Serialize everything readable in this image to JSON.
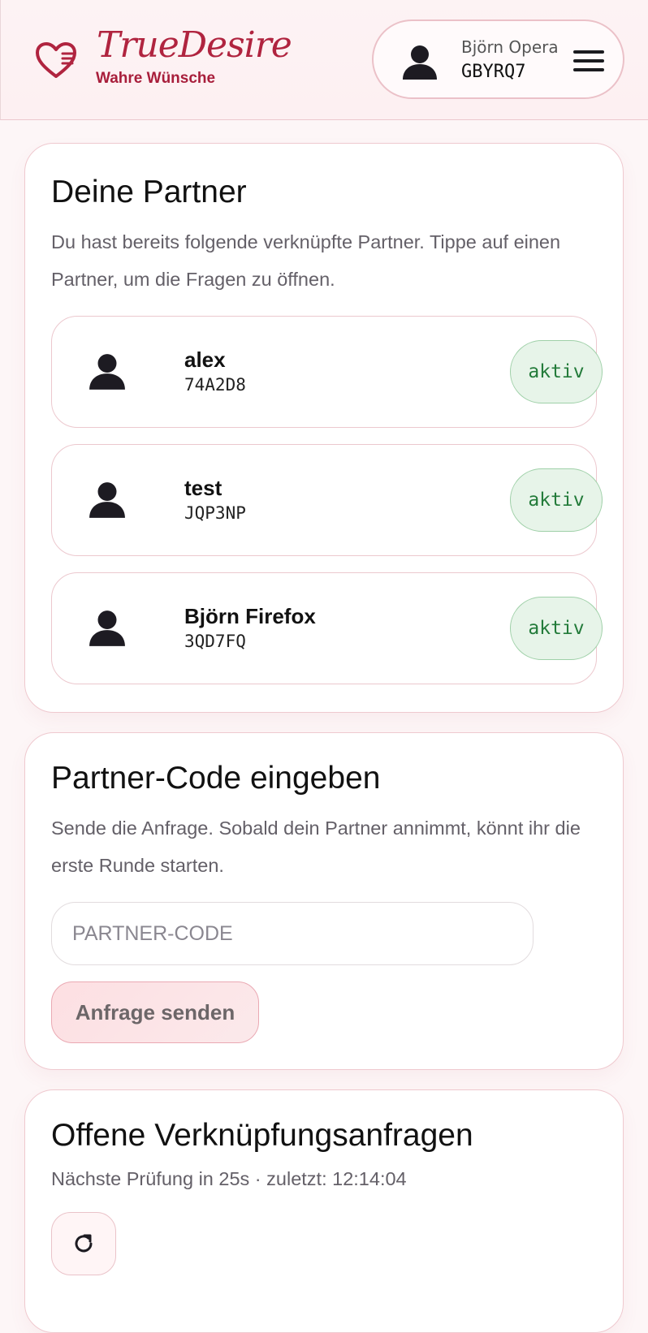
{
  "header": {
    "logo_title": "TrueDesire",
    "logo_subtitle": "Wahre Wünsche",
    "user": {
      "name": "Björn Opera",
      "code": "GBYRQ7"
    },
    "icons": {
      "logo": "heart-logo-icon",
      "avatar": "user-icon",
      "menu": "hamburger-menu-icon"
    }
  },
  "partners_card": {
    "title": "Deine Partner",
    "description": "Du hast bereits folgende verknüpfte Partner. Tippe auf einen Partner, um die Fragen zu öffnen.",
    "partners": [
      {
        "name": "alex",
        "code": "74A2D8",
        "status": "aktiv"
      },
      {
        "name": "test",
        "code": "JQP3NP",
        "status": "aktiv"
      },
      {
        "name": "Björn Firefox",
        "code": "3QD7FQ",
        "status": "aktiv"
      }
    ]
  },
  "code_card": {
    "title": "Partner-Code eingeben",
    "description": "Sende die Anfrage. Sobald dein Partner annimmt, könnt ihr die erste Runde starten.",
    "input_value": "",
    "input_placeholder": "PARTNER-CODE",
    "submit_label": "Anfrage senden"
  },
  "requests_card": {
    "title": "Offene Verknüpfungsanfragen",
    "status_text": "Nächste Prüfung in 25s · zuletzt: 12:14:04",
    "refresh_icon": "refresh-icon"
  },
  "colors": {
    "brand": "#b0243f",
    "active_badge_bg": "#e7f4e9",
    "active_badge_text": "#237b3a",
    "card_border": "#efc9cf"
  }
}
